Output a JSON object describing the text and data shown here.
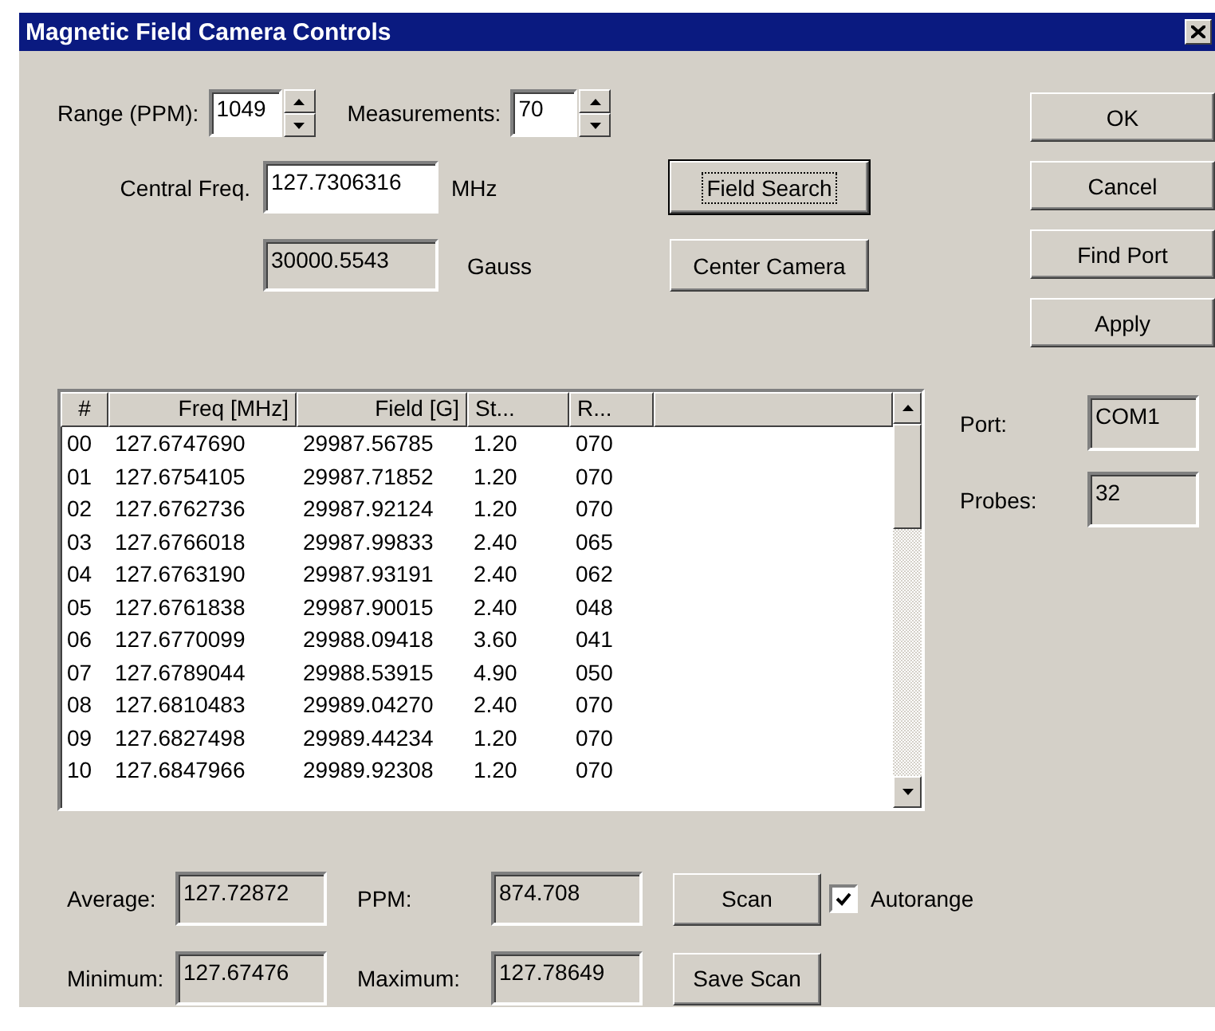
{
  "window": {
    "title": "Magnetic Field Camera Controls"
  },
  "range": {
    "label": "Range (PPM):",
    "value": "1049"
  },
  "measurements": {
    "label": "Measurements:",
    "value": "70"
  },
  "central_freq": {
    "label": "Central Freq.",
    "value": "127.7306316",
    "unit": "MHz"
  },
  "field": {
    "value": "30000.5543",
    "unit": "Gauss"
  },
  "actions": [
    {
      "label": "Field Search",
      "focused": true
    },
    {
      "label": "Center Camera",
      "focused": false
    }
  ],
  "buttons": [
    {
      "label": "OK"
    },
    {
      "label": "Cancel"
    },
    {
      "label": "Find Port"
    },
    {
      "label": "Apply"
    }
  ],
  "table": {
    "columns": [
      "#",
      "Freq [MHz]",
      "Field [G]",
      "St...",
      "R..."
    ],
    "rows": [
      [
        "00",
        "127.6747690",
        "29987.56785",
        "1.20",
        "070"
      ],
      [
        "01",
        "127.6754105",
        "29987.71852",
        "1.20",
        "070"
      ],
      [
        "02",
        "127.6762736",
        "29987.92124",
        "1.20",
        "070"
      ],
      [
        "03",
        "127.6766018",
        "29987.99833",
        "2.40",
        "065"
      ],
      [
        "04",
        "127.6763190",
        "29987.93191",
        "2.40",
        "062"
      ],
      [
        "05",
        "127.6761838",
        "29987.90015",
        "2.40",
        "048"
      ],
      [
        "06",
        "127.6770099",
        "29988.09418",
        "3.60",
        "041"
      ],
      [
        "07",
        "127.6789044",
        "29988.53915",
        "4.90",
        "050"
      ],
      [
        "08",
        "127.6810483",
        "29989.04270",
        "2.40",
        "070"
      ],
      [
        "09",
        "127.6827498",
        "29989.44234",
        "1.20",
        "070"
      ],
      [
        "10",
        "127.6847966",
        "29989.92308",
        "1.20",
        "070"
      ]
    ]
  },
  "port": {
    "label": "Port:",
    "value": "COM1"
  },
  "probes": {
    "label": "Probes:",
    "value": "32"
  },
  "stats": [
    {
      "label": "Average:",
      "value": "127.72872"
    },
    {
      "label": "PPM:",
      "value": "874.708"
    },
    {
      "label": "Minimum:",
      "value": "127.67476"
    },
    {
      "label": "Maximum:",
      "value": "127.78649"
    }
  ],
  "scan_buttons": [
    {
      "label": "Scan"
    },
    {
      "label": "Save Scan"
    }
  ],
  "autorange": {
    "label": "Autorange",
    "checked": true
  }
}
